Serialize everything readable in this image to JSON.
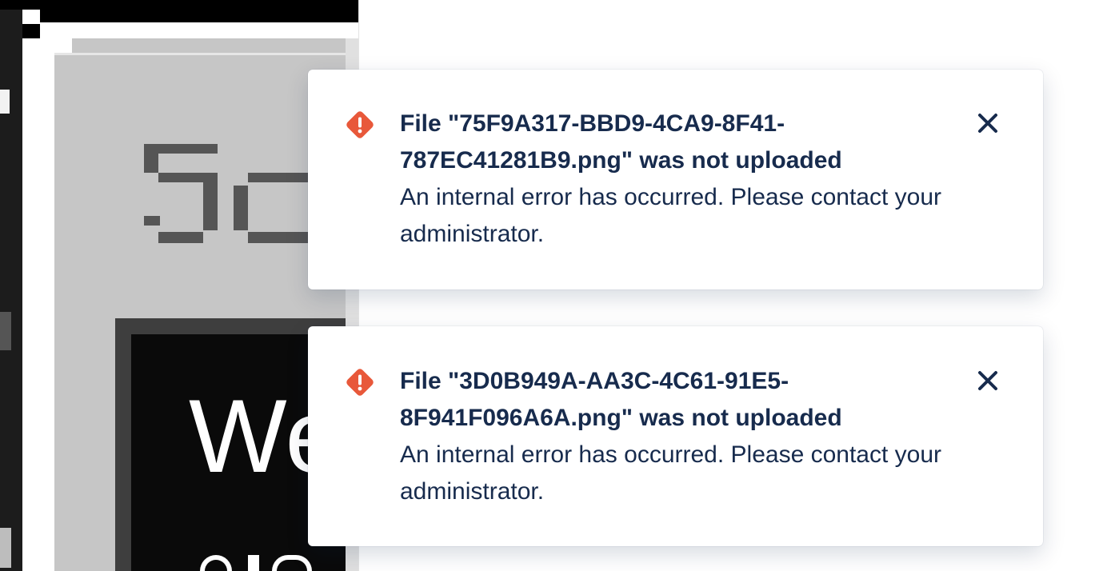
{
  "background": {
    "preview_text_top": "So",
    "preview_text_dark": "We"
  },
  "notifications": [
    {
      "title": "File \"75F9A317-BBD9-4CA9-8F41-787EC41281B9.png\" was not uploaded",
      "message": "An internal error has occurred. Please contact your administrator.",
      "icon": "error-icon",
      "close_icon": "close-icon"
    },
    {
      "title": "File \"3D0B949A-AA3C-4C61-91E5-8F941F096A6A.png\" was not uploaded",
      "message": "An internal error has occurred. Please contact your administrator.",
      "icon": "error-icon",
      "close_icon": "close-icon"
    }
  ],
  "colors": {
    "error": "#e8583a",
    "text": "#172b4d",
    "preview_gray": "#c6c6c6",
    "preview_black": "#0a0a0a"
  }
}
